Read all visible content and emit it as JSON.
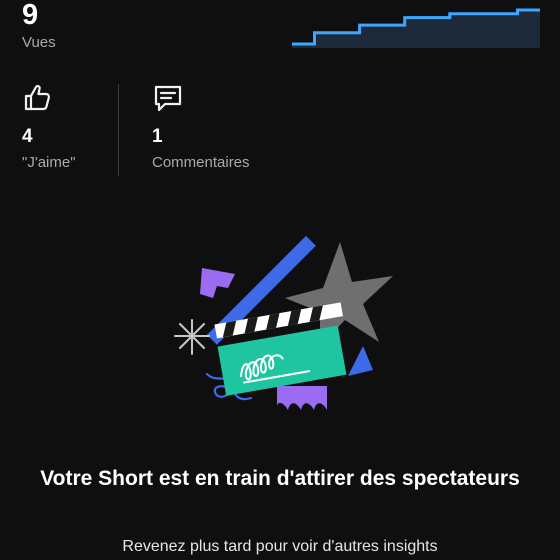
{
  "views": {
    "count": "9",
    "label": "Vues"
  },
  "sparkline": {
    "line_color": "#3ea6ff",
    "fill_color": "#1e2a3a",
    "values": [
      0,
      3,
      3,
      5,
      5,
      7,
      7,
      8,
      8,
      8,
      9,
      9
    ]
  },
  "stats": {
    "likes": {
      "icon": "thumbs-up-icon",
      "value": "4",
      "label": "\"J'aime\""
    },
    "comments": {
      "icon": "comment-icon",
      "value": "1",
      "label": "Commentaires"
    }
  },
  "illustration": {
    "icon": "clapperboard-illustration",
    "colors": {
      "green": "#1fc4a0",
      "blue": "#3d6be8",
      "purple": "#9b6cf2",
      "gray": "#6f6f6f"
    }
  },
  "message": {
    "headline": "Votre Short est en train d'attirer des spectateurs",
    "subline": "Revenez plus tard pour voir d'autres insights"
  }
}
